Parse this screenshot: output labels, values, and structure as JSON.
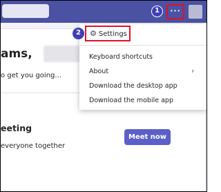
{
  "topbar": {
    "more_label": "···",
    "step1": "1"
  },
  "page": {
    "welcome_visible": "ams,",
    "subtitle": "o get you going...",
    "meeting_title": "eeting",
    "meeting_desc": "everyone together",
    "meet_now_label": "Meet now"
  },
  "menu": {
    "step2": "2",
    "settings_label": "Settings",
    "items": [
      {
        "label": "Keyboard shortcuts"
      },
      {
        "label": "About"
      },
      {
        "label": "Download the desktop app"
      },
      {
        "label": "Download the mobile app"
      }
    ]
  },
  "colors": {
    "topbar": "#4b52a3",
    "accent": "#5b5fc7",
    "highlight_border": "#e0102a",
    "badge": "#3f3fb8"
  }
}
